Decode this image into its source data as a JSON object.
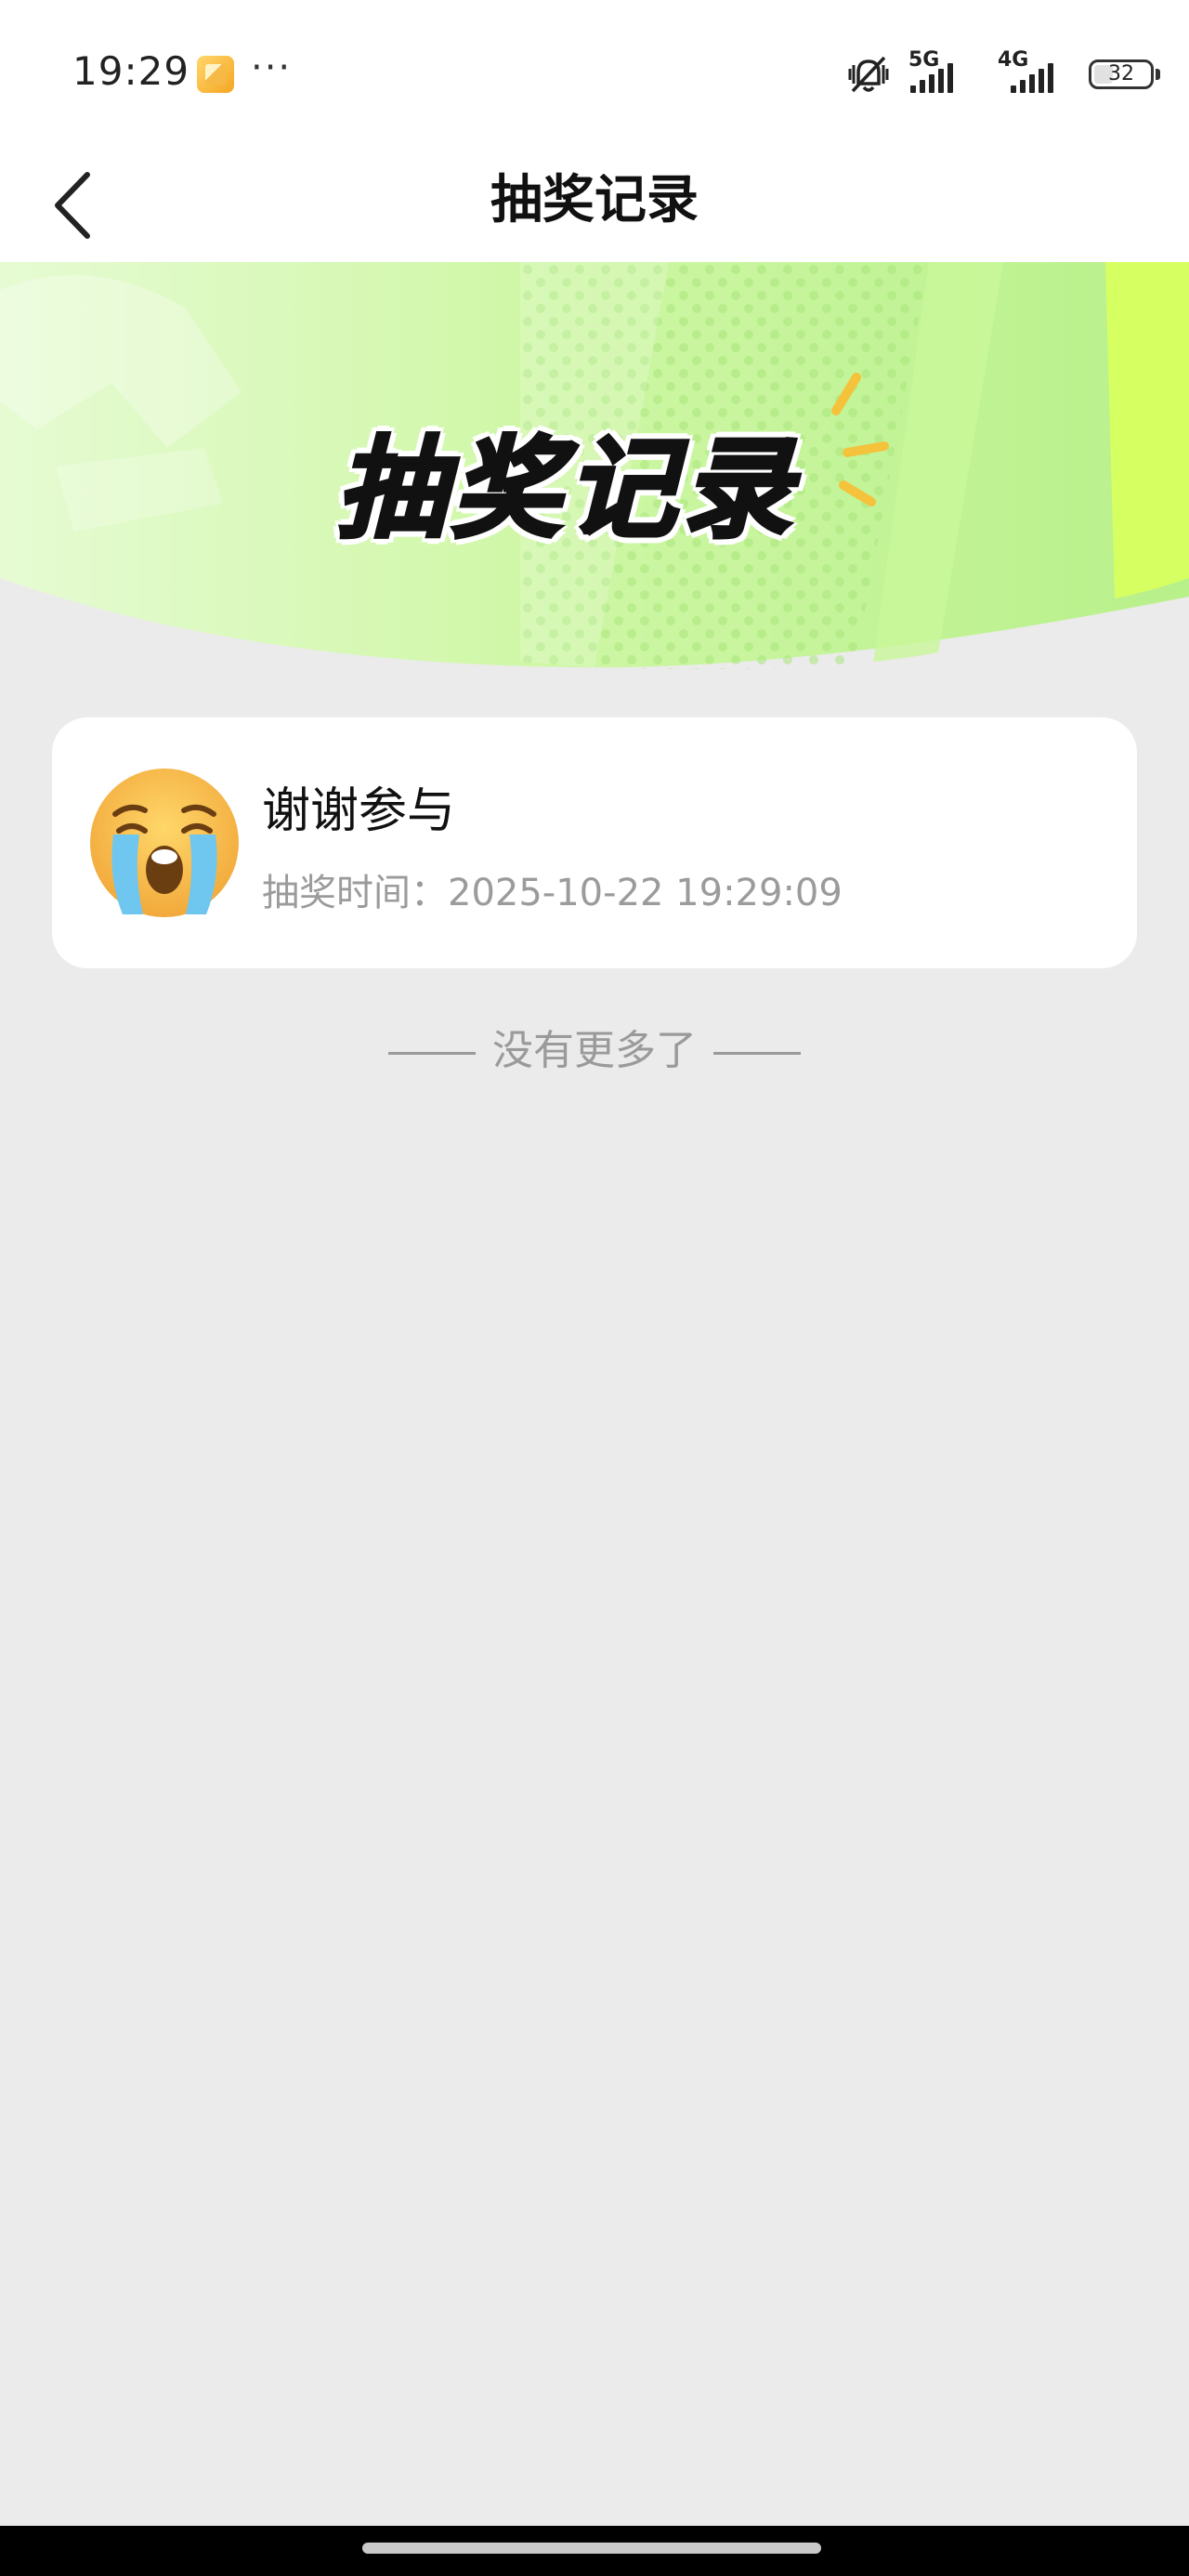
{
  "status_bar": {
    "time": "19:29",
    "more": "···",
    "network_1": "5G",
    "network_2": "4G",
    "battery": "32"
  },
  "nav": {
    "title": "抽奖记录"
  },
  "banner": {
    "title": "抽奖记录",
    "colors": {
      "light": "#e9ffd2",
      "mid": "#c6f59a",
      "accent": "#d8ff5a"
    }
  },
  "records": [
    {
      "icon": "crying-face-emoji",
      "title": "谢谢参与",
      "time_label": "抽奖时间：",
      "time_value": "2025-10-22 19:29:09"
    }
  ],
  "footer": {
    "no_more": "没有更多了"
  }
}
